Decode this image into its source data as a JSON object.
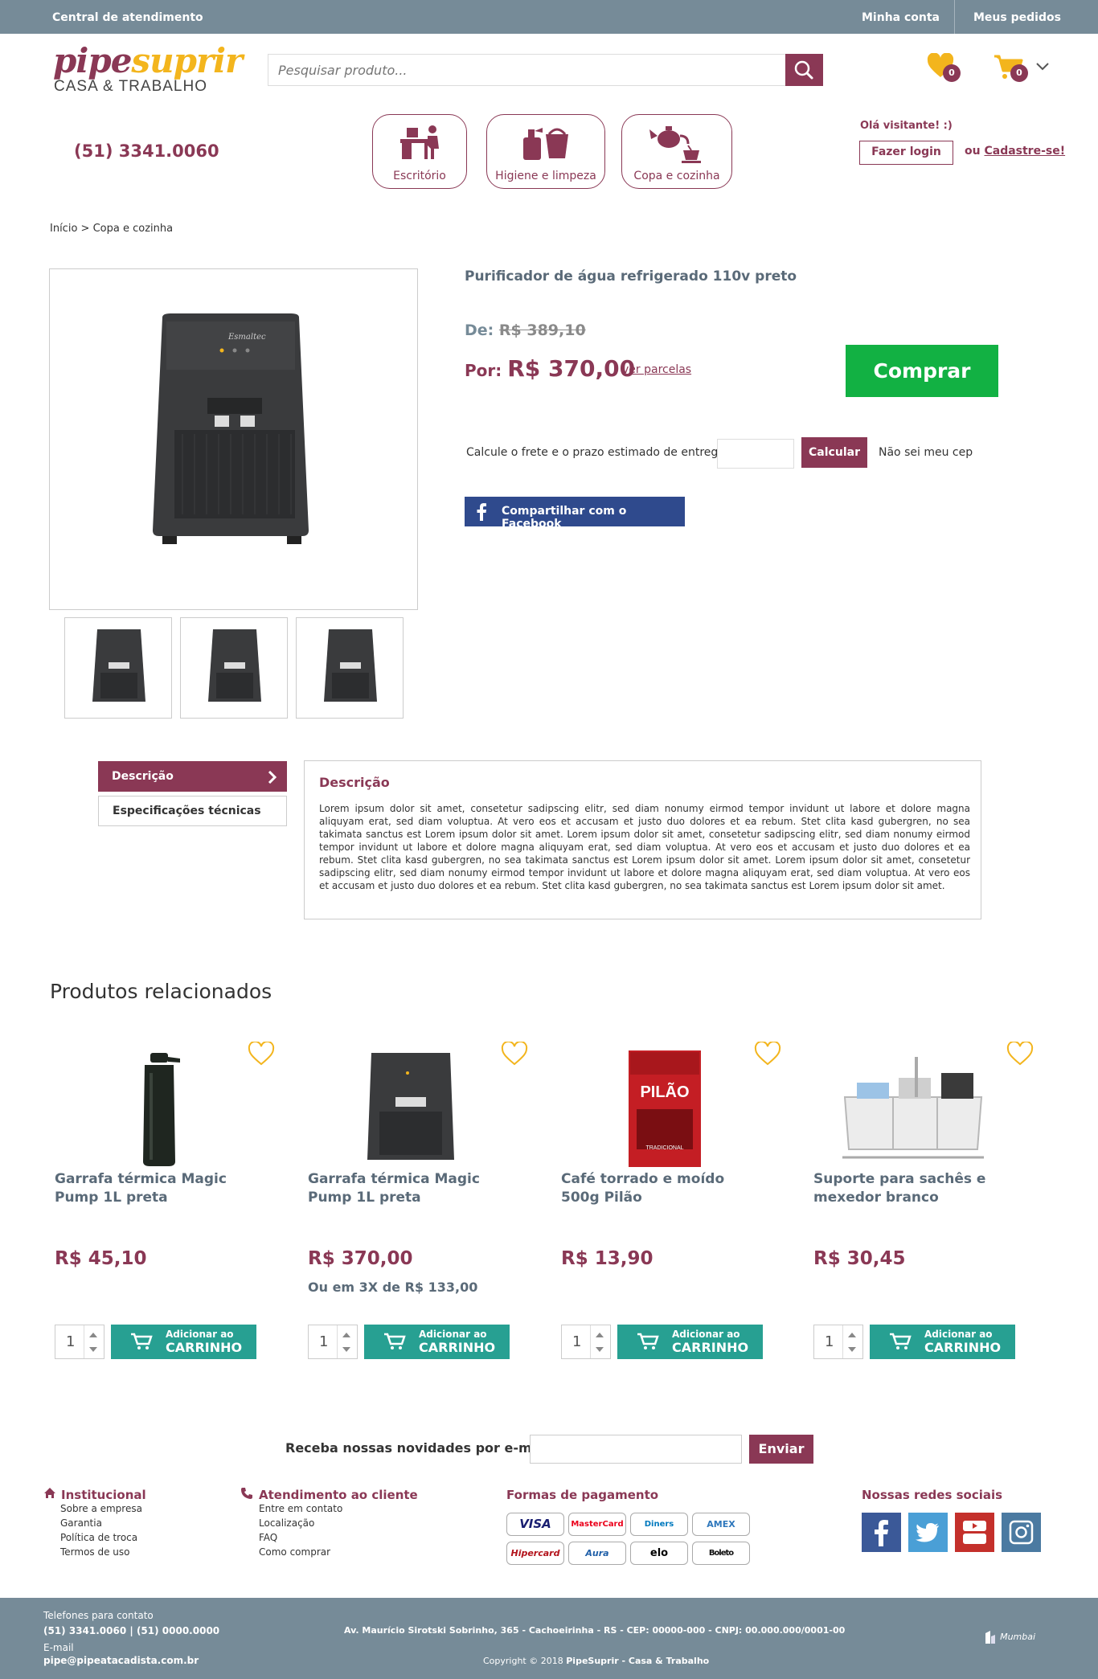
{
  "topbar": {
    "central": "Central de atendimento",
    "minha_conta": "Minha conta",
    "meus_pedidos": "Meus pedidos"
  },
  "logo": {
    "part1": "pipe",
    "part2": "suprir",
    "sub": "CASA & TRABALHO"
  },
  "search": {
    "placeholder": "Pesquisar produto..."
  },
  "wishlist": {
    "count": "0"
  },
  "cart": {
    "count": "0"
  },
  "phone": "(51) 3341.0060",
  "categories": [
    {
      "label": "Escritório",
      "icon": "office-desk-icon"
    },
    {
      "label": "Higiene e limpeza",
      "icon": "cleaning-icon"
    },
    {
      "label": "Copa e cozinha",
      "icon": "teapot-icon"
    }
  ],
  "user": {
    "hello": "Olá visitante! :)",
    "login": "Fazer login",
    "ou": "ou",
    "register": "Cadastre-se!"
  },
  "breadcrumb": {
    "home": "Início",
    "sep": ">",
    "current": "Copa e cozinha"
  },
  "product": {
    "title": "Purificador de água refrigerado 110v preto",
    "de_label": "De:",
    "old_price": "R$ 389,10",
    "por_label": "Por:",
    "price": "R$ 370,00",
    "installments_link": "ver parcelas",
    "buy": "Comprar",
    "freight_label": "Calcule o frete e o prazo estimado de entrega:",
    "calc": "Calcular",
    "nao_sei": "Não sei meu cep",
    "share": "Compartilhar com o Facebook",
    "brand_mark": "Esmaltec"
  },
  "tabs": {
    "description": "Descrição",
    "specs": "Especificações técnicas"
  },
  "description": {
    "title": "Descrição",
    "body": "Lorem ipsum dolor sit amet, consetetur sadipscing elitr, sed diam nonumy eirmod tempor invidunt ut labore et dolore magna aliquyam erat, sed diam voluptua. At vero eos et accusam et justo duo dolores et ea rebum. Stet clita kasd gubergren, no sea takimata sanctus est Lorem ipsum dolor sit amet. Lorem ipsum dolor sit amet, consetetur sadipscing elitr, sed diam nonumy eirmod tempor invidunt ut labore et dolore magna aliquyam erat, sed diam voluptua. At vero eos et accusam et justo duo dolores et ea rebum. Stet clita kasd gubergren, no sea takimata sanctus est Lorem ipsum dolor sit amet. Lorem ipsum dolor sit amet, consetetur sadipscing elitr, sed diam nonumy eirmod tempor invidunt ut labore et dolore magna aliquyam erat, sed diam voluptua. At vero eos et accusam et justo duo dolores et ea rebum. Stet clita kasd gubergren, no sea takimata sanctus est Lorem ipsum dolor sit amet."
  },
  "related": {
    "title": "Produtos relacionados",
    "add_line1": "Adicionar ao",
    "add_line2": "CARRINHO",
    "items": [
      {
        "name": "Garrafa térmica Magic Pump 1L preta",
        "price": "R$ 45,10",
        "installments": "",
        "qty": "1",
        "image": "thermos"
      },
      {
        "name": "Garrafa térmica Magic Pump 1L preta",
        "price": "R$ 370,00",
        "installments": "Ou em 3X de R$ 133,00",
        "qty": "1",
        "image": "purifier"
      },
      {
        "name": "Café torrado e moído 500g Pilão",
        "price": "R$ 13,90",
        "installments": "",
        "qty": "1",
        "image": "coffee"
      },
      {
        "name": "Suporte para sachês e mexedor branco",
        "price": "R$ 30,45",
        "installments": "",
        "qty": "1",
        "image": "sachet-holder"
      }
    ],
    "coffee_brand": "PILÃO",
    "coffee_tag": "TRADICIONAL"
  },
  "newsletter": {
    "label": "Receba nossas novidades por e-mail:",
    "button": "Enviar"
  },
  "footer": {
    "institucional": {
      "title": "Institucional",
      "links": [
        "Sobre a empresa",
        "Garantia",
        "Política de troca",
        "Termos de uso"
      ]
    },
    "atendimento": {
      "title": "Atendimento ao cliente",
      "links": [
        "Entre em contato",
        "Localização",
        "FAQ",
        "Como comprar"
      ]
    },
    "pagamento": {
      "title": "Formas de pagamento",
      "cards": [
        "VISA",
        "MasterCard",
        "Diners",
        "AMEX",
        "Hipercard",
        "Aura",
        "elo",
        "Boleto"
      ]
    },
    "social": {
      "title": "Nossas redes sociais",
      "networks": [
        "facebook",
        "twitter",
        "youtube",
        "instagram"
      ]
    }
  },
  "bottom": {
    "phones_label": "Telefones para contato",
    "phones": "(51) 3341.0060 | (51) 0000.0000",
    "email_label": "E-mail",
    "email": "pipe@pipeatacadista.com.br",
    "address": "Av. Maurício Sirotski Sobrinho, 365 - Cachoeirinha - RS - CEP: 00000-000 - CNPJ: 00.000.000/0001-00",
    "copyright_prefix": "Copyright © 2018",
    "copyright_brand": "PipeSuprir - Casa & Trabalho",
    "agency": "Mumbai"
  },
  "colors": {
    "primary": "#8a3855",
    "accent": "#f3b51d",
    "slate": "#768b98",
    "buy": "#12b143",
    "teal": "#27a092"
  }
}
